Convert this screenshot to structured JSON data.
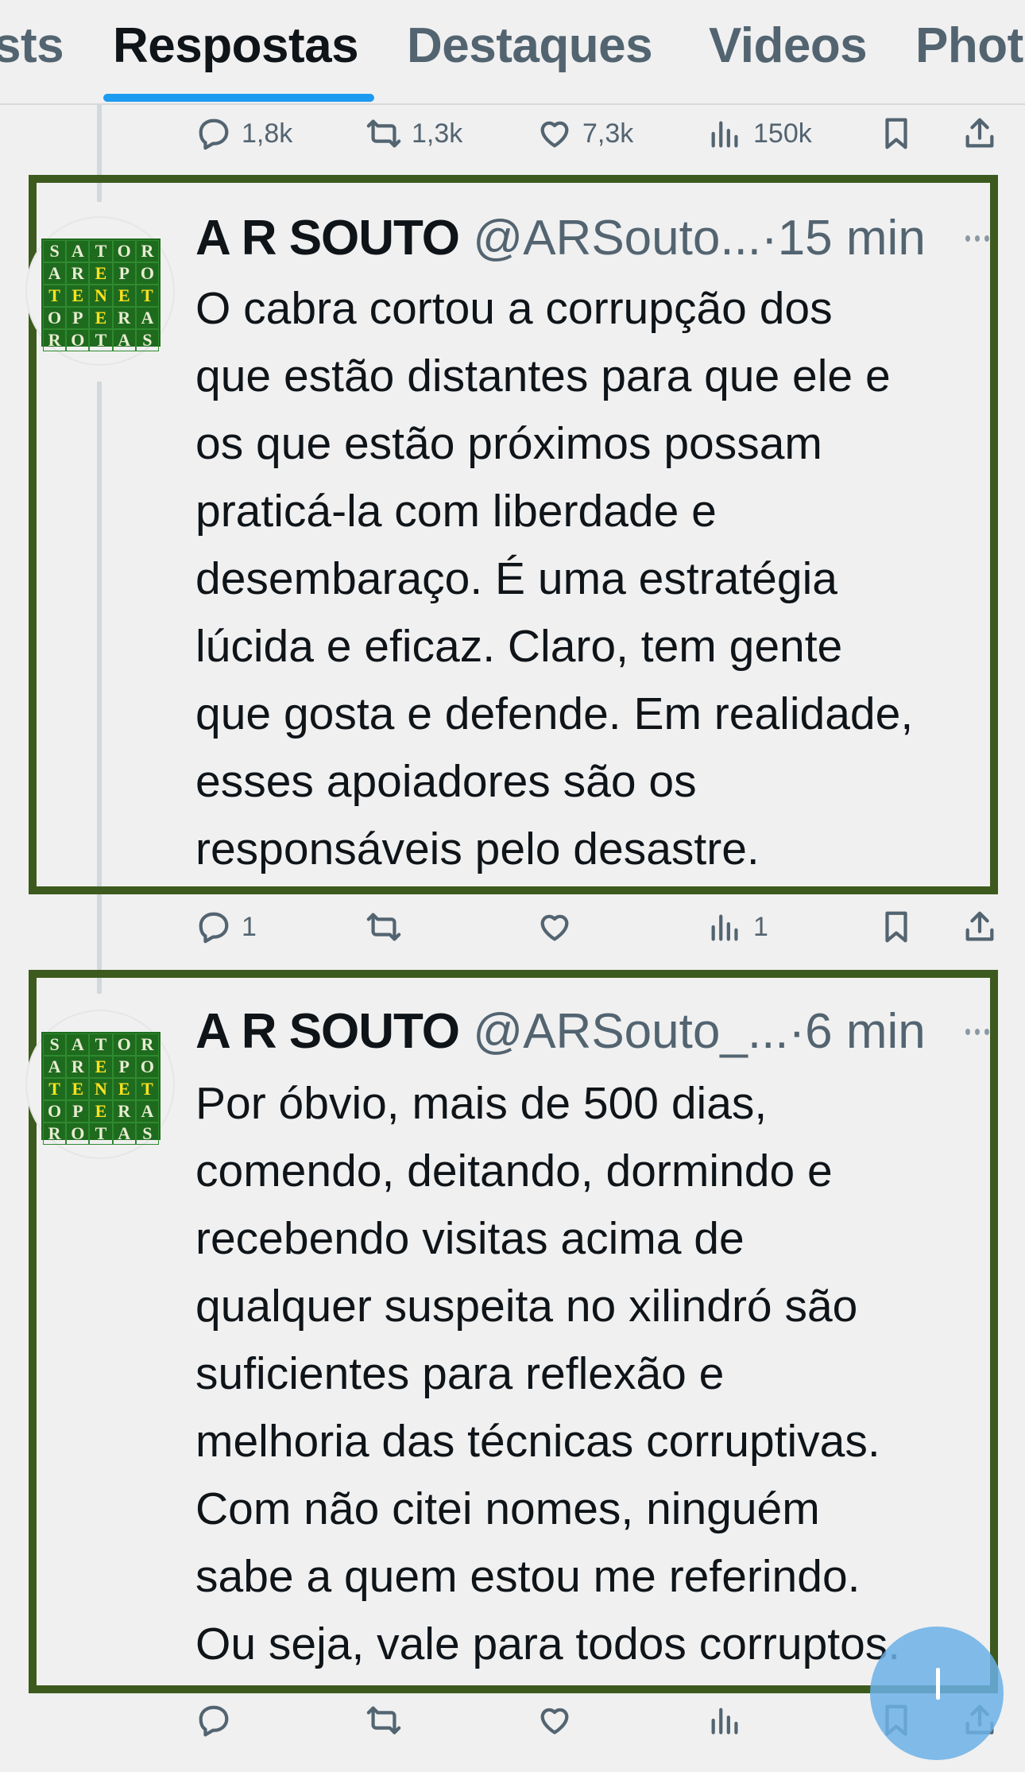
{
  "tabs": [
    {
      "label": "sts",
      "active": false
    },
    {
      "label": "Respostas",
      "active": true
    },
    {
      "label": "Destaques",
      "active": false
    },
    {
      "label": "Videos",
      "active": false
    },
    {
      "label": "Phot",
      "active": false
    }
  ],
  "top_actions": {
    "replies": "1,8k",
    "reposts": "1,3k",
    "likes": "7,3k",
    "views": "150k"
  },
  "tweets": [
    {
      "name": "A R SOUTO",
      "handle": "@ARSouto...",
      "sep": "·",
      "time": "15 min",
      "text": "O cabra cortou a corrupção dos\nque estão distantes para que ele e\nos que estão próximos possam\npraticá-la com liberdade e\ndesembaraço. É uma estratégia\nlúcida e eficaz. Claro, tem gente\nque gosta e defende. Em realidade,\nesses apoiadores são os\nresponsáveis pelo desastre.",
      "actions": {
        "replies": "1",
        "reposts": "",
        "likes": "",
        "views": "1"
      }
    },
    {
      "name": "A R SOUTO",
      "handle": "@ARSouto_...",
      "sep": "·",
      "time": "6 min",
      "text": "Por óbvio, mais de 500 dias,\ncomendo, deitando, dormindo e\nrecebendo visitas acima de\nqualquer suspeita no xilindró são\nsuficientes para reflexão e\nmelhoria das técnicas corruptivas.\nCom não citei nomes, ninguém\nsabe a quem estou me referindo.\nOu seja, vale para todos corruptos.",
      "actions": {
        "replies": "",
        "reposts": "",
        "likes": "",
        "views": ""
      }
    }
  ],
  "avatar_grid": [
    "S",
    "A",
    "T",
    "O",
    "R",
    "A",
    "R",
    "E",
    "P",
    "O",
    "T",
    "E",
    "N",
    "E",
    "T",
    "O",
    "P",
    "E",
    "R",
    "A",
    "R",
    "O",
    "T",
    "A",
    "S"
  ],
  "colors": {
    "accent": "#1d9bf0",
    "highlight_border": "#3d5a1e",
    "avatar_bg": "#1e6b1e",
    "avatar_letter_hl": "#ffe21f"
  }
}
